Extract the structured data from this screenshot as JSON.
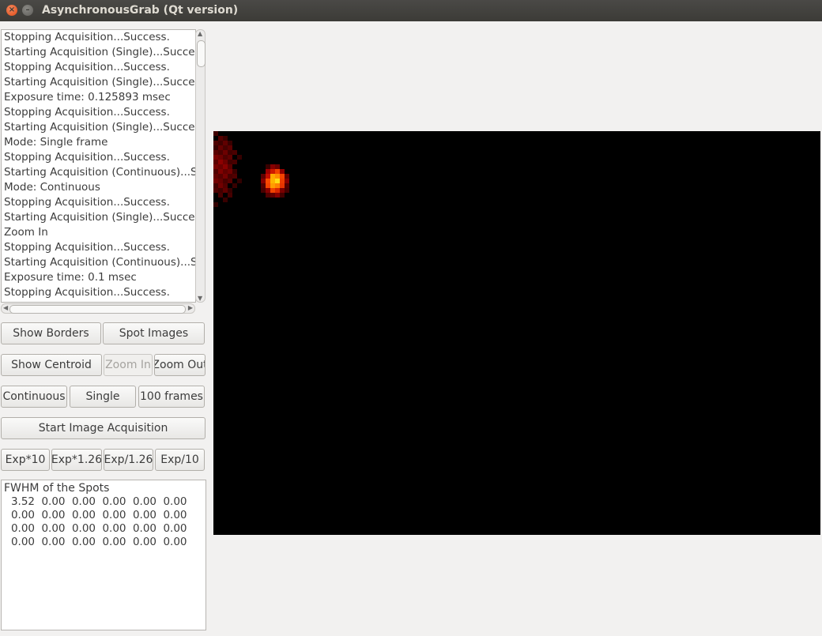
{
  "window": {
    "title": "AsynchronousGrab (Qt version)"
  },
  "log": [
    "Stopping Acquisition...Success.",
    "Starting Acquisition (Single)...Success.",
    "Stopping Acquisition...Success.",
    "Starting Acquisition (Single)...Success.",
    "Exposure time: 0.125893 msec",
    "Stopping Acquisition...Success.",
    "Starting Acquisition (Single)...Success.",
    "Mode: Single frame",
    "Stopping Acquisition...Success.",
    "Starting Acquisition (Continuous)...Success.",
    "Mode: Continuous",
    "Stopping Acquisition...Success.",
    "Starting Acquisition (Single)...Success.",
    "Zoom In",
    "Stopping Acquisition...Success.",
    "Starting Acquisition (Continuous)...Success.",
    "Exposure time: 0.1 msec",
    "Stopping Acquisition...Success."
  ],
  "buttons": {
    "show_borders": "Show Borders",
    "spot_images": "Spot Images",
    "show_centroid": "Show Centroid",
    "zoom_in": "Zoom In",
    "zoom_out": "Zoom Out",
    "continuous": "Continuous",
    "single": "Single",
    "frames100": "100 frames",
    "start_acq": "Start Image Acquisition",
    "exp_x10": "Exp*10",
    "exp_x126": "Exp*1.26",
    "exp_d126": "Exp/1.26",
    "exp_d10": "Exp/10"
  },
  "fwhm": {
    "title": "FWHM of the Spots",
    "rows": [
      [
        "3.52",
        "0.00",
        "0.00",
        "0.00",
        "0.00",
        "0.00"
      ],
      [
        "0.00",
        "0.00",
        "0.00",
        "0.00",
        "0.00",
        "0.00"
      ],
      [
        "0.00",
        "0.00",
        "0.00",
        "0.00",
        "0.00",
        "0.00"
      ],
      [
        "0.00",
        "0.00",
        "0.00",
        "0.00",
        "0.00",
        "0.00"
      ]
    ]
  },
  "colors": {
    "titlebar": "#3c3b37",
    "close": "#df4a16",
    "image_bg": "#000000",
    "spot_hot": "#ffe000",
    "spot_warm": "#c05000"
  }
}
